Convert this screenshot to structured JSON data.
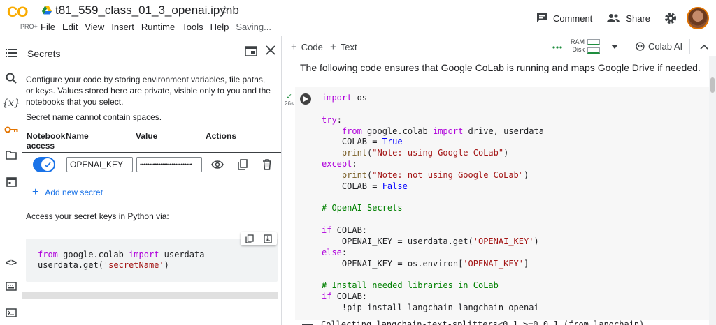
{
  "app": {
    "logo_text": "CO",
    "plan": "PRO+",
    "title": "t81_559_class_01_3_openai.ipynb"
  },
  "menu": [
    "File",
    "Edit",
    "View",
    "Insert",
    "Runtime",
    "Tools",
    "Help",
    "Saving..."
  ],
  "header": {
    "comment_label": "Comment",
    "share_label": "Share"
  },
  "secrets": {
    "title": "Secrets",
    "description": "Configure your code by storing environment variables, file paths, or keys. Values stored here are private, visible only to you and the notebooks that you select.",
    "warning": "Secret name cannot contain spaces.",
    "columns": {
      "notebook_access": "Notebook access",
      "name": "Name",
      "value": "Value",
      "actions": "Actions"
    },
    "rows": [
      {
        "name": "OPENAI_KEY",
        "value_masked": "••••••••••••••••••••••••••••",
        "access_enabled": true
      }
    ],
    "add_label": "Add new secret",
    "access_text": "Access your secret keys in Python via:",
    "snippet_lines": [
      "from google.colab import userdata",
      "userdata.get('secretName')"
    ]
  },
  "toolbar": {
    "code_label": "Code",
    "text_label": "Text",
    "ram_label": "RAM",
    "disk_label": "Disk",
    "colab_ai_label": "Colab AI"
  },
  "notebook": {
    "intro_text": "The following code ensures that Google CoLab is running and maps Google Drive if needed.",
    "cell_exec_time": "26s",
    "output_line": "Collecting langchain-text-splitters<0.1,>=0.0.1 (from langchain)"
  },
  "colors": {
    "accent": "#1a73e8",
    "logo": "#f9ab00",
    "success": "#1e8e3e"
  }
}
